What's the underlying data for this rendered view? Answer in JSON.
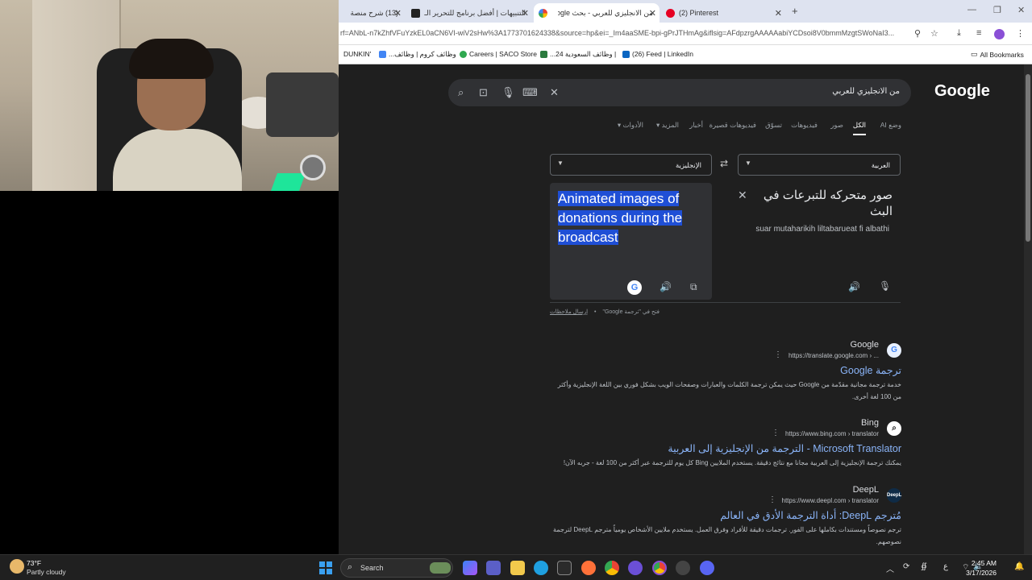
{
  "browser": {
    "tabs": [
      {
        "label": "(13) شرح منصة",
        "active": false
      },
      {
        "label": "التنبيهات | أفضل برنامج للتحرير الـ",
        "active": false
      },
      {
        "label": "من الانجليزي للعربي - بحث Google",
        "active": true
      },
      {
        "label": "(2) Pinterest",
        "active": false
      }
    ],
    "url": "rf=ANbL-n7kZhfVFuYzkEL0aCN6VI-wiV2sHw%3A1773701624338&source=hp&ei=_Im4aaSME-bpi-gPrJTHmAg&iflsig=AFdpzrgAAAAAabiYCDsoi8V0bmmMzgtSWoNaI3..."
  },
  "bookmarks": [
    {
      "label": "DUNKIN'"
    },
    {
      "label": "...وظائف كروم | وظائف"
    },
    {
      "label": "Careers | SACO Store"
    },
    {
      "label": "...وظائف السعودية 24 |"
    },
    {
      "label": "(26) Feed | LinkedIn"
    },
    {
      "label": "All Bookmarks"
    }
  ],
  "search": {
    "logo": "Google",
    "query": "من الانجليزي للعربي"
  },
  "filters": [
    {
      "label": "وضع AI",
      "active": false
    },
    {
      "label": "الكل",
      "active": true
    },
    {
      "label": "صور",
      "active": false
    },
    {
      "label": "فيديوهات",
      "active": false
    },
    {
      "label": "تسوّق",
      "active": false
    },
    {
      "label": "فيديوهات قصيرة",
      "active": false
    },
    {
      "label": "أخبار",
      "active": false
    },
    {
      "label": "المزيد",
      "active": false
    },
    {
      "label": "الأدوات",
      "active": false
    }
  ],
  "translate": {
    "source_lang": "العربية",
    "target_lang": "الإنجليزية",
    "source_text": "صور متحركه للتبرعات في البث",
    "transliteration": "suar mutaharikih liltabarueat fi albathi",
    "translated_text": "Animated images of donations during the broadcast",
    "open_in": "فتح في \"ترجمة Google\"",
    "feedback": "إرسال ملاحظات"
  },
  "results": [
    {
      "site": "Google",
      "url": "https://translate.google.com › ...",
      "title": "ترجمة Google",
      "snippet": "خدمة ترجمة مجانية مقدّمة من Google حيث يمكن ترجمة الكلمات والعبارات وصفحات الويب بشكل فوري بين اللغة الإنجليزية وأكثر من 100 لغة أخرى."
    },
    {
      "site": "Bing",
      "url": "https://www.bing.com › translator",
      "title": "Microsoft Translator - الترجمة من الإنجليزية إلى العربية",
      "snippet": "يمكنك ترجمة الإنجليزية إلى العربية مجانا مع نتائج دقيقة. يستخدم الملايين Bing كل يوم للترجمة عبر أكثر من 100 لغة - جربه الآن!"
    },
    {
      "site": "DeepL",
      "url": "https://www.deepl.com › translator",
      "title": "مُترجم DeepL: أداة الترجمة الأدق في العالم",
      "snippet": "ترجم نصوصاً ومستندات بكاملها على الفور. ترجمات دقيقة للأفراد وفرق العمل. يستخدم ملايين الأشخاص يومياً مترجم DeepL لترجمة نصوصهم."
    }
  ],
  "taskbar": {
    "temperature": "73°F",
    "condition": "Partly cloudy",
    "search_label": "Search",
    "time": "2:45 AM",
    "date": "3/17/2026",
    "lang": "ع"
  },
  "colors": {
    "link": "#8ab4f8",
    "highlight": "#1f4fd6",
    "page_bg": "#1f1f1f"
  }
}
